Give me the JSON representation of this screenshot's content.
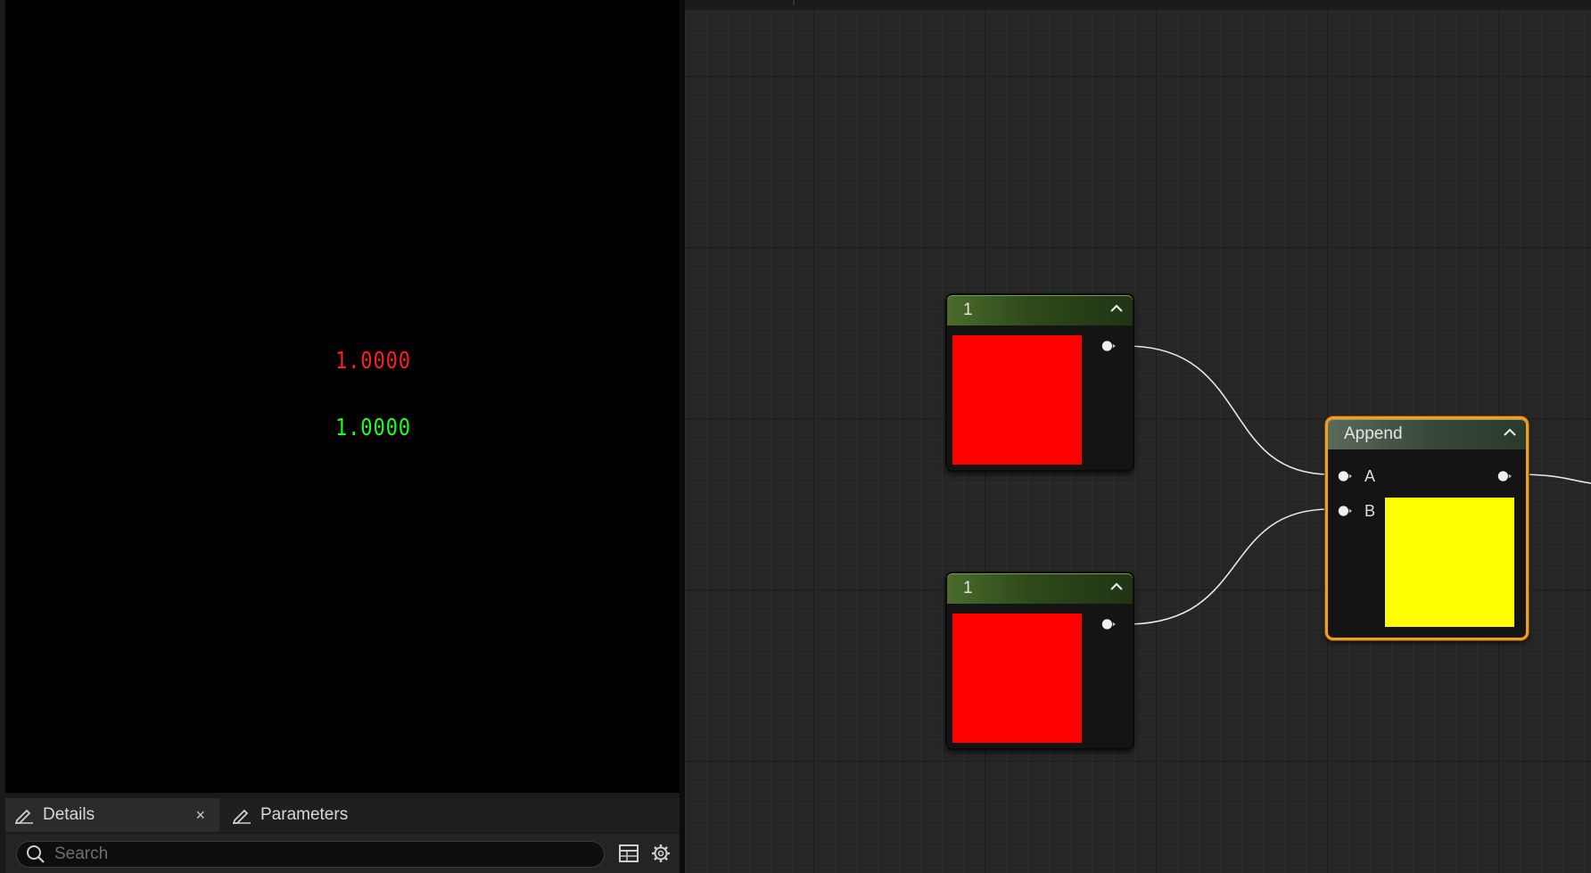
{
  "preview": {
    "value_red": "1.0000",
    "value_green": "1.0000",
    "colors": {
      "red": "#ff1e1e",
      "green": "#1eff1e"
    }
  },
  "details_panel": {
    "tabs": [
      {
        "label": "Details",
        "icon": "pencil-icon",
        "closable": true,
        "active": true
      },
      {
        "label": "Parameters",
        "icon": "pencil-icon",
        "closable": false,
        "active": false
      }
    ],
    "close_glyph": "×",
    "search": {
      "placeholder": "Search"
    }
  },
  "graph": {
    "nodes": [
      {
        "id": "constant-1",
        "title": "1",
        "swatch_color": "#ff0000"
      },
      {
        "id": "constant-2",
        "title": "1",
        "swatch_color": "#ff0000"
      },
      {
        "id": "append",
        "title": "Append",
        "inputs": [
          "A",
          "B"
        ],
        "swatch_color": "#ffff00",
        "selected": true
      }
    ]
  }
}
